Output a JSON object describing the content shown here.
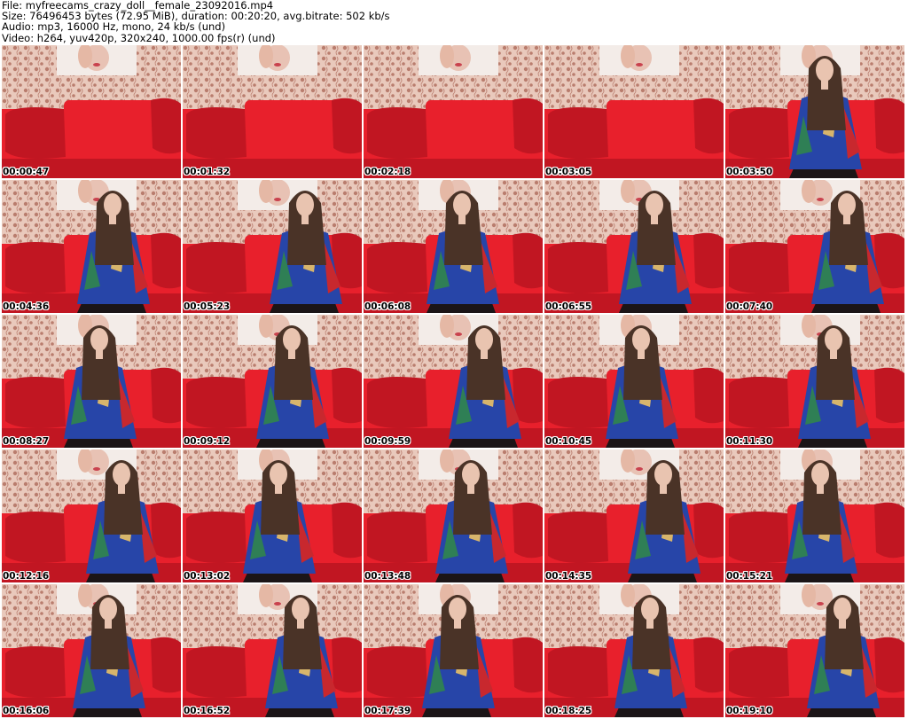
{
  "header": {
    "file_line": "File: myfreecams_crazy_doll__female_23092016.mp4",
    "size_line": "Size: 76496453 bytes (72.95 MiB), duration: 00:20:20, avg.bitrate: 502 kb/s",
    "audio_line": "Audio: mp3, 16000 Hz, mono, 24 kb/s (und)",
    "video_line": "Video: h264, yuv420p, 320x240, 1000.00 fps(r) (und)"
  },
  "colors": {
    "wall": "#e9c9bc",
    "wall_pattern": "#b97d6e",
    "couch": "#e8202c",
    "couch_dark": "#c11622",
    "poster": "#f3ece8",
    "hair": "#4a3327",
    "skin": "#e9c4b0",
    "robe_blue": "#2745a8",
    "robe_red": "#c8282e",
    "robe_yellow": "#d7b56c",
    "robe_green": "#2f7f55",
    "legs": "#1b1517"
  },
  "thumbnails": [
    {
      "time": "00:00:47",
      "person": false
    },
    {
      "time": "00:01:32",
      "person": false
    },
    {
      "time": "00:02:18",
      "person": false
    },
    {
      "time": "00:03:05",
      "person": false
    },
    {
      "time": "00:03:50",
      "person": true
    },
    {
      "time": "00:04:36",
      "person": true
    },
    {
      "time": "00:05:23",
      "person": true
    },
    {
      "time": "00:06:08",
      "person": true
    },
    {
      "time": "00:06:55",
      "person": true
    },
    {
      "time": "00:07:40",
      "person": true
    },
    {
      "time": "00:08:27",
      "person": true
    },
    {
      "time": "00:09:12",
      "person": true
    },
    {
      "time": "00:09:59",
      "person": true
    },
    {
      "time": "00:10:45",
      "person": true
    },
    {
      "time": "00:11:30",
      "person": true
    },
    {
      "time": "00:12:16",
      "person": true
    },
    {
      "time": "00:13:02",
      "person": true
    },
    {
      "time": "00:13:48",
      "person": true
    },
    {
      "time": "00:14:35",
      "person": true
    },
    {
      "time": "00:15:21",
      "person": true
    },
    {
      "time": "00:16:06",
      "person": true
    },
    {
      "time": "00:16:52",
      "person": true
    },
    {
      "time": "00:17:39",
      "person": true
    },
    {
      "time": "00:18:25",
      "person": true
    },
    {
      "time": "00:19:10",
      "person": true
    }
  ]
}
